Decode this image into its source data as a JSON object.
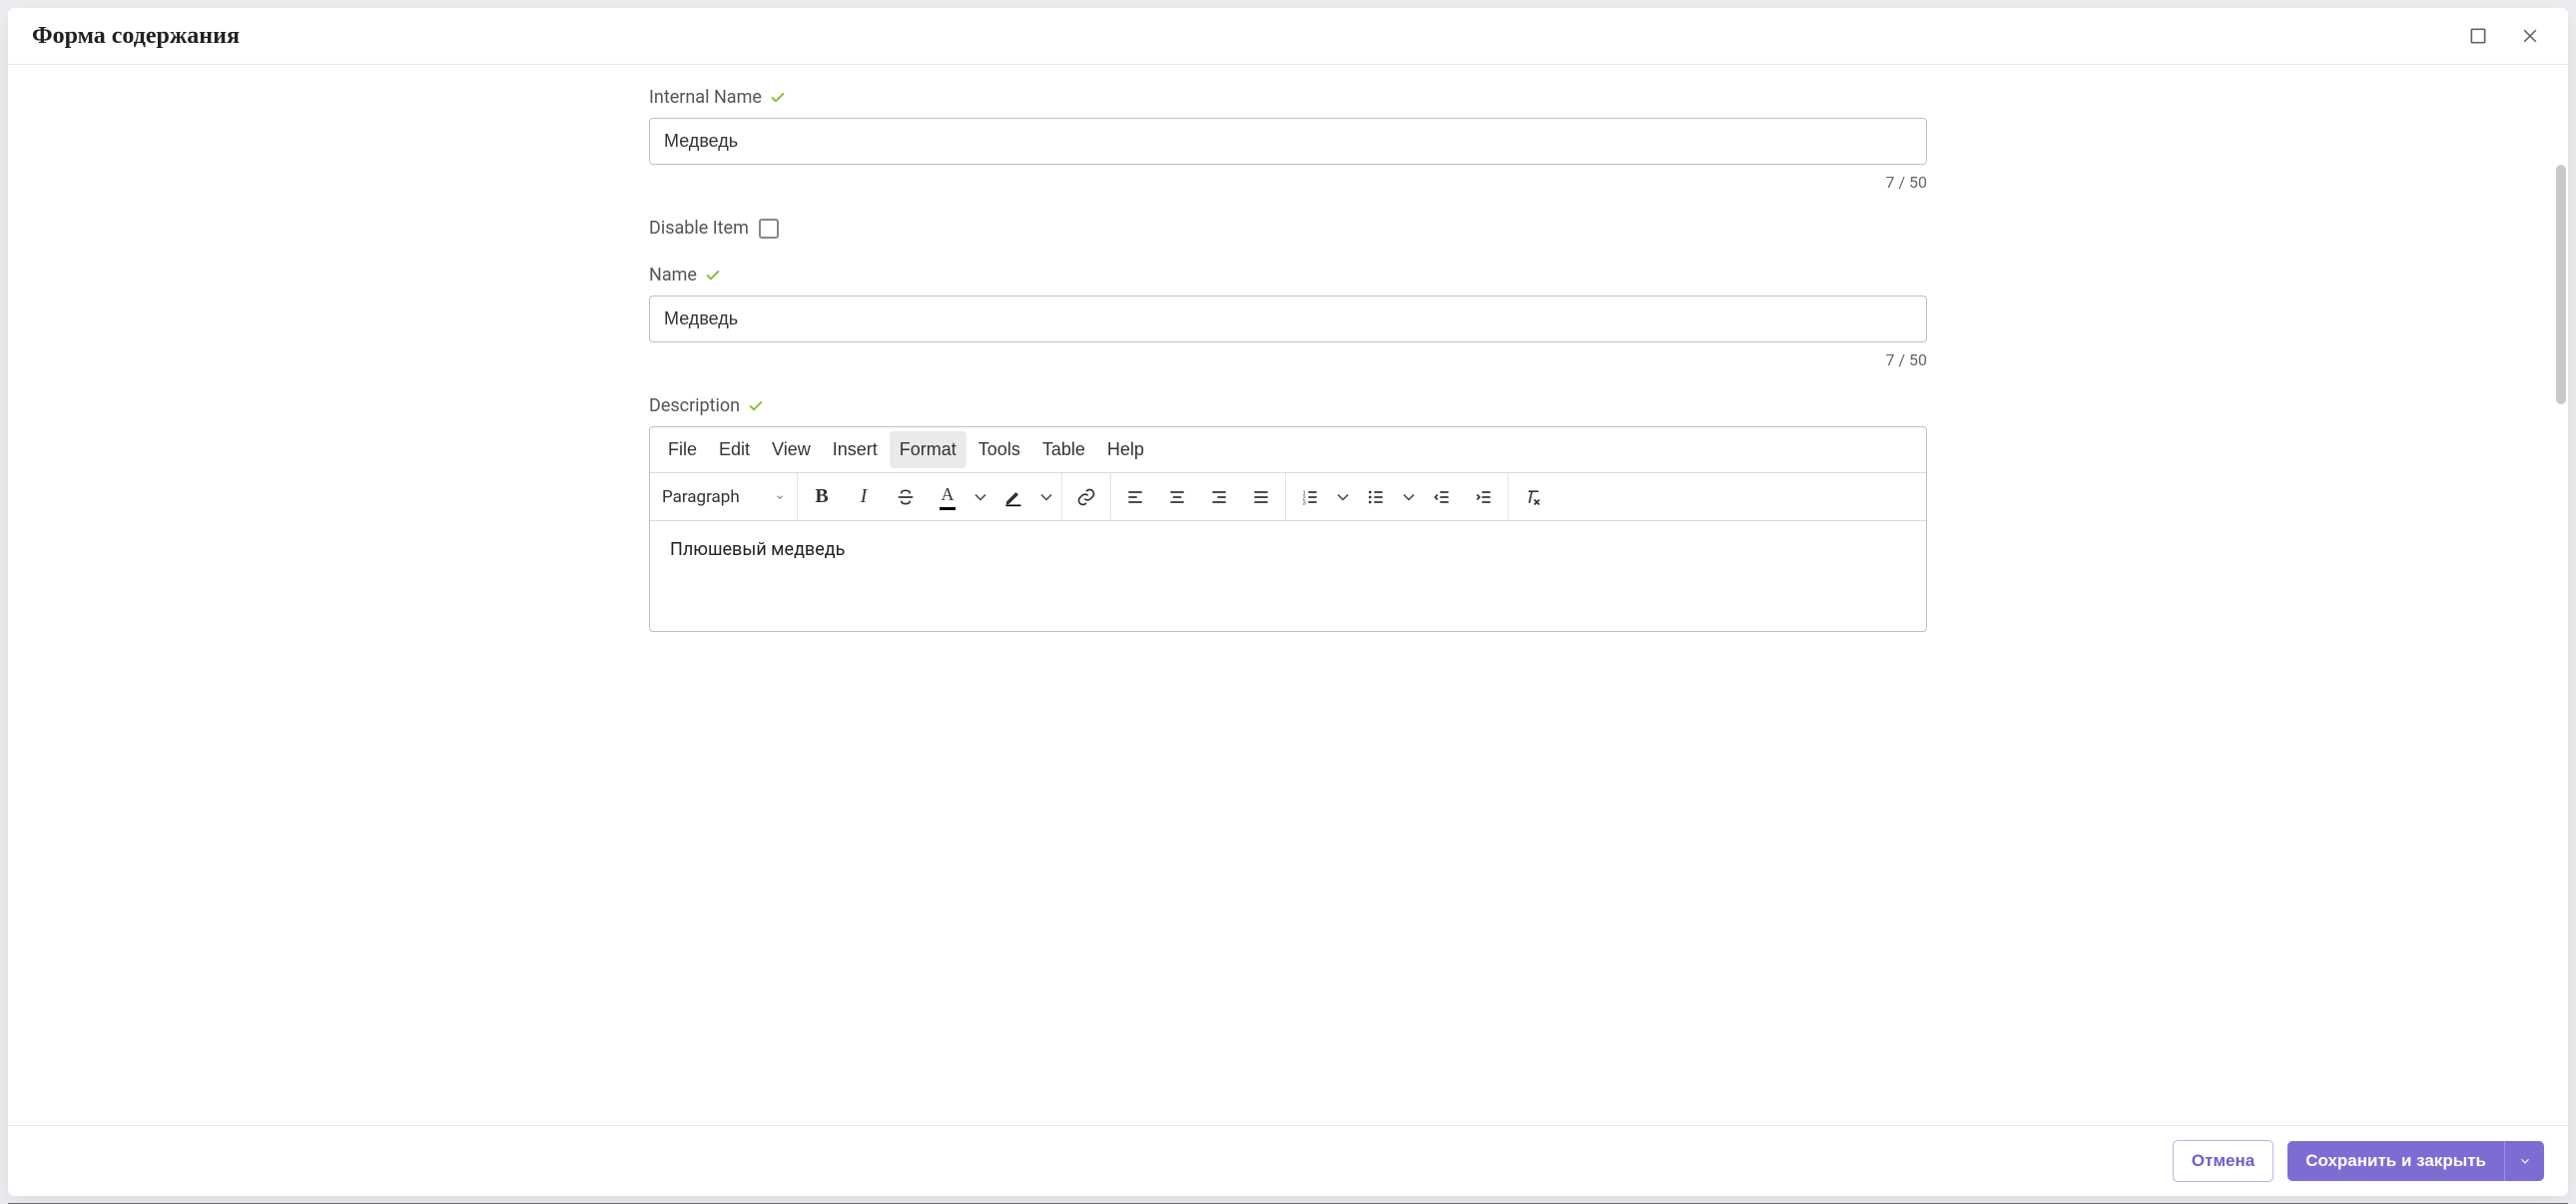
{
  "modal": {
    "title": "Форма содержания"
  },
  "fields": {
    "internal_name": {
      "label": "Internal Name",
      "value": "Медведь",
      "counter": "7 / 50"
    },
    "disable_item": {
      "label": "Disable Item",
      "checked": false
    },
    "name": {
      "label": "Name",
      "value": "Медведь",
      "counter": "7 / 50"
    },
    "description": {
      "label": "Description",
      "content": "Плюшевый медведь"
    }
  },
  "editor": {
    "menus": {
      "file": "File",
      "edit": "Edit",
      "view": "View",
      "insert": "Insert",
      "format": "Format",
      "tools": "Tools",
      "table": "Table",
      "help": "Help"
    },
    "block_format": "Paragraph"
  },
  "footer": {
    "cancel": "Отмена",
    "save": "Сохранить и закрыть"
  }
}
